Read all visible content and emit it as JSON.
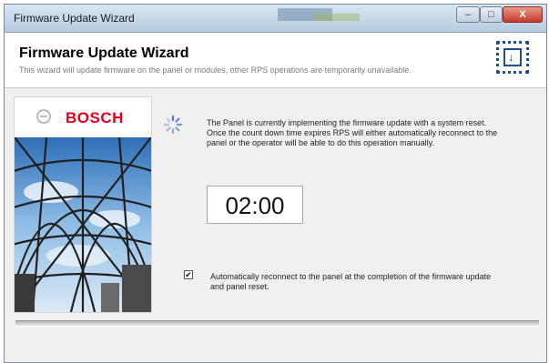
{
  "window": {
    "title": "Firmware Update Wizard",
    "controls": {
      "minimize": "–",
      "maximize": "□",
      "close": "X"
    }
  },
  "header": {
    "title": "Firmware Update Wizard",
    "subtitle": "This wizard will update firmware on the panel or modules, other RPS operations are temporarily unavailable.",
    "icon": "download-chip-icon"
  },
  "sidebar": {
    "brand": "BOSCH",
    "brand_color": "#e2001a",
    "image": "glass-dome-building"
  },
  "main": {
    "spinner_icon": "busy-spinner-icon",
    "message": "The Panel is currently implementing the firmware update with a system reset. Once the count down time expires RPS will either automatically reconnect to the panel or the operator will be able to do this operation manually.",
    "countdown": "02:00",
    "auto_reconnect": {
      "checked": true,
      "mark": "✔",
      "label": "Automatically reconnect to the panel at the completion of the firmware update and panel reset."
    }
  },
  "colors": {
    "accent": "#1e4f8f",
    "brand": "#e2001a"
  }
}
